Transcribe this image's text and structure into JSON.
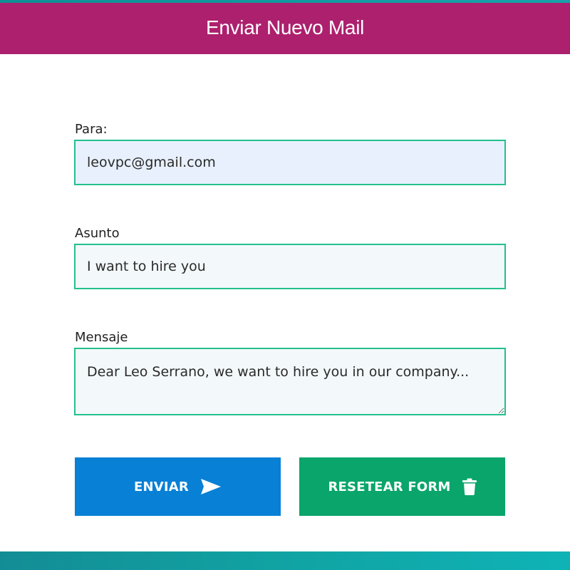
{
  "header": {
    "title": "Enviar Nuevo Mail"
  },
  "form": {
    "para": {
      "label": "Para:",
      "value": "leovpc@gmail.com"
    },
    "asunto": {
      "label": "Asunto",
      "value": "I want to hire you"
    },
    "mensaje": {
      "label": "Mensaje",
      "value": "Dear Leo Serrano, we want to hire you in our company..."
    }
  },
  "buttons": {
    "send": {
      "label": "ENVIAR",
      "icon": "send-icon"
    },
    "reset": {
      "label": "RESETEAR FORM",
      "icon": "trash-icon"
    }
  },
  "colors": {
    "header": "#ad206e",
    "field_border": "#23c08d",
    "send_button": "#0880d6",
    "reset_button": "#0aa56b",
    "footer": "#11a3a3"
  }
}
